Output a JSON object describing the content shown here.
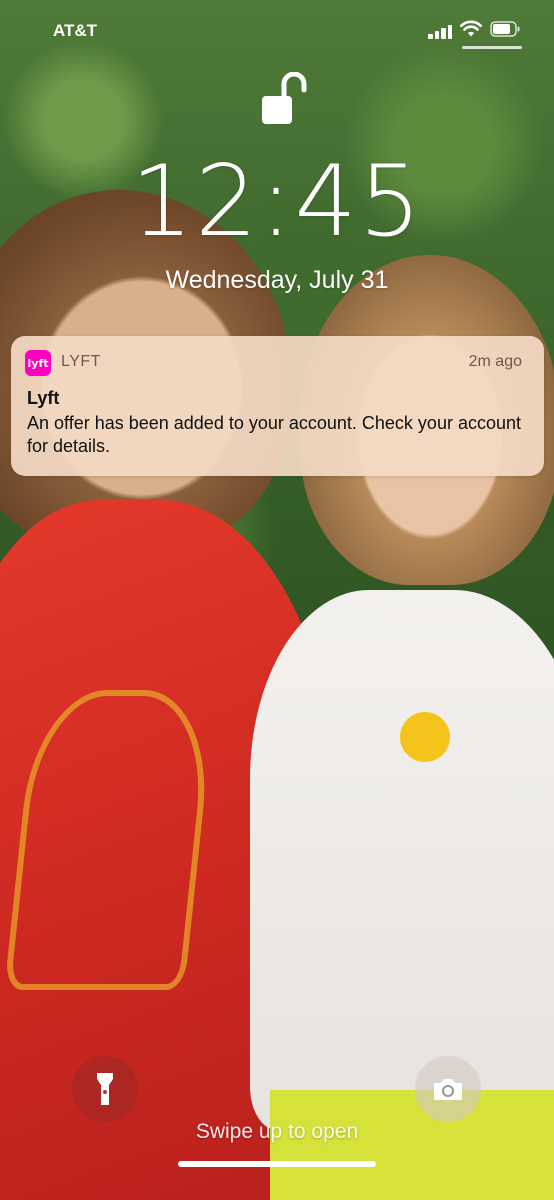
{
  "status_bar": {
    "carrier": "AT&T",
    "signal_icon": "cellular-signal-icon",
    "wifi_icon": "wifi-icon",
    "battery_icon": "battery-icon"
  },
  "lock_icon": "unlocked-padlock-icon",
  "lockscreen": {
    "time": "12:45",
    "date": "Wednesday, July 31"
  },
  "notification": {
    "app_icon_text": "lyft",
    "app_icon_color": "#FF00BF",
    "app_name": "LYFT",
    "time": "2m ago",
    "title": "Lyft",
    "body": "An offer has been added to your account. Check your account for details."
  },
  "controls": {
    "flashlight_icon": "flashlight-icon",
    "camera_icon": "camera-icon",
    "swipe_hint": "Swipe up to open"
  }
}
